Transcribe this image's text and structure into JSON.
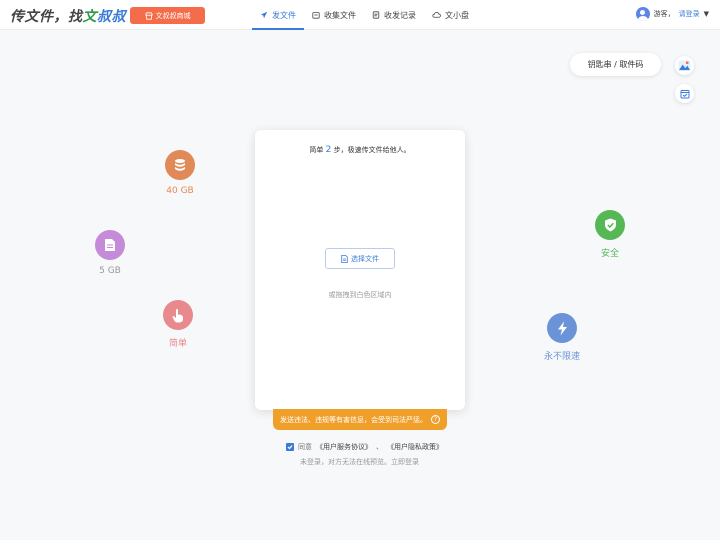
{
  "header": {
    "logo": {
      "part1": "传文件，找",
      "part2": "文",
      "part3": "叔叔"
    },
    "store_button": "文叔叔商城",
    "nav": [
      {
        "label": "发文件",
        "icon": "send-icon",
        "active": true
      },
      {
        "label": "收集文件",
        "icon": "collect-icon",
        "active": false
      },
      {
        "label": "收发记录",
        "icon": "record-icon",
        "active": false
      },
      {
        "label": "文小盘",
        "icon": "cloud-disk-icon",
        "active": false
      }
    ],
    "user": {
      "guest": "游客，",
      "login": "请登录"
    }
  },
  "tools": {
    "key_button": "钥匙串 / 取件码"
  },
  "features": {
    "storage": {
      "label": "40 GB",
      "color": "#e08a59"
    },
    "file_size": {
      "label": "5 GB",
      "color": "#c58ad8"
    },
    "simple": {
      "label": "简单",
      "color": "#e8898e"
    },
    "safe": {
      "label": "安全",
      "color": "#56b757"
    },
    "speed": {
      "label": "永不限速",
      "color": "#6b94d8"
    }
  },
  "card": {
    "title_pre": "简单",
    "title_step": "2",
    "title_post": "步，极速传文件给他人。",
    "select_button": "选择文件",
    "drag_hint": "或拖拽到白色区域内"
  },
  "warning": "发送违法、违规等有害信息，会受到司法严惩。",
  "agreement": {
    "prefix": "同意",
    "service": "《用户服务协议》",
    "sep": "、",
    "privacy": "《用户隐私政策》"
  },
  "notice": "未登录，对方无法在线预览。立即登录",
  "colors": {
    "accent": "#3b7bd8",
    "store": "#f46c4a",
    "warning": "#f0a02a"
  }
}
